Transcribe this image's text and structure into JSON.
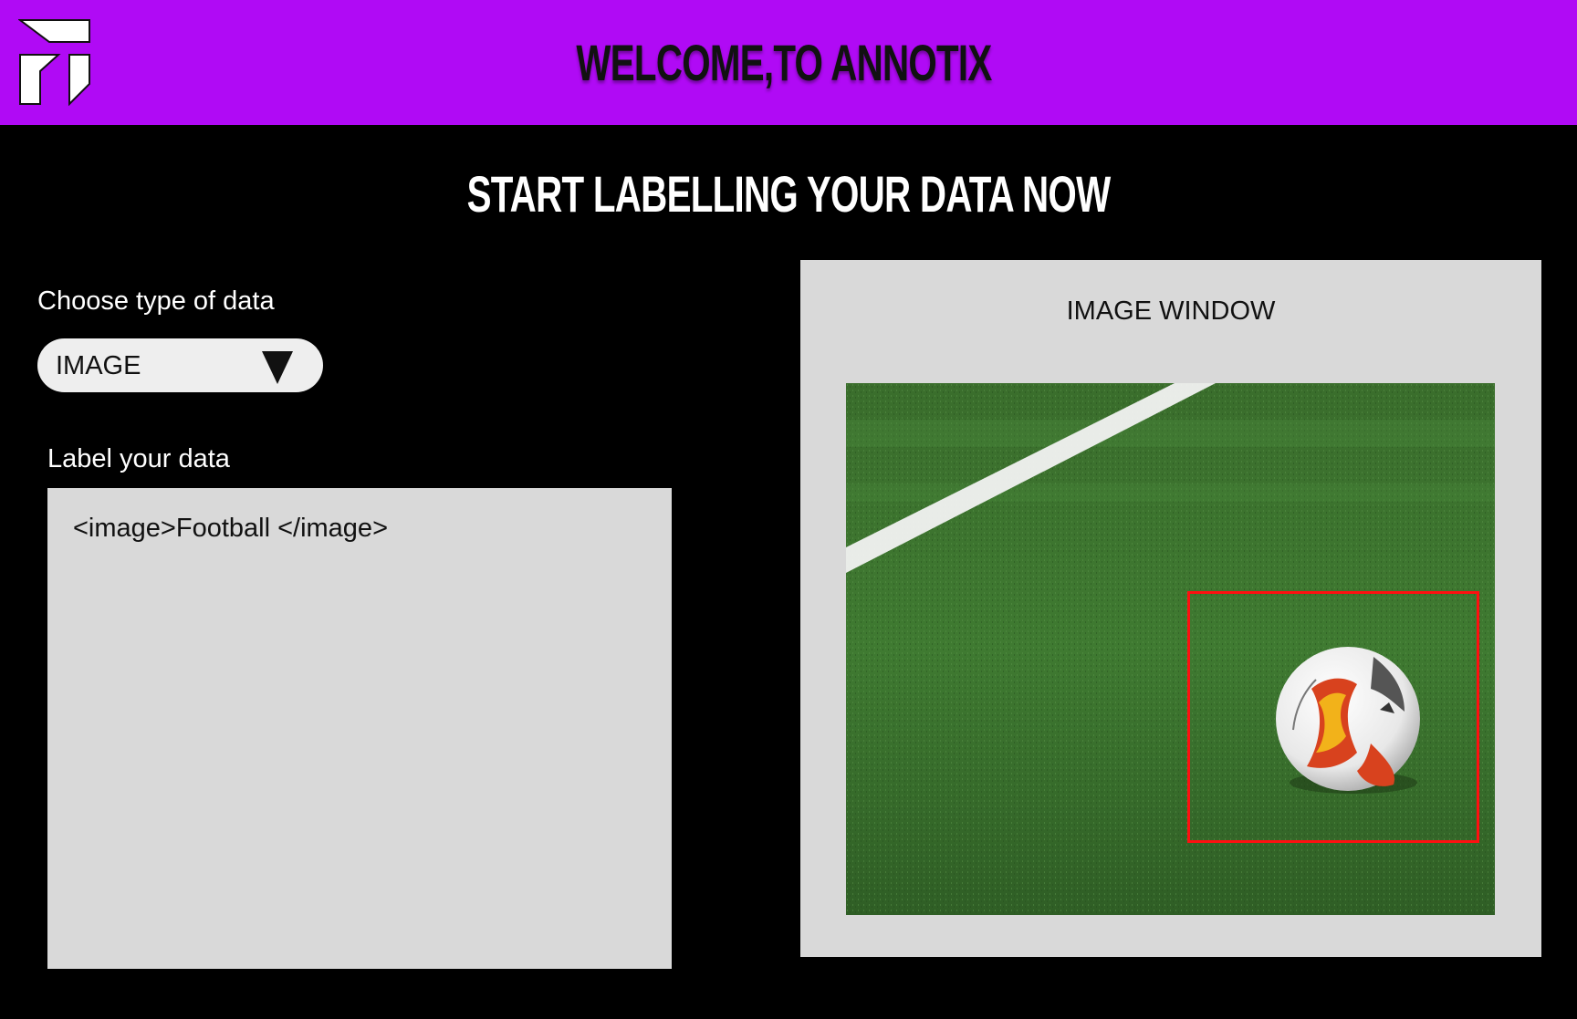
{
  "header": {
    "title": "WELCOME,TO ANNOTIX",
    "background_color": "#b00af5",
    "logo_icon": "annotix-logo-icon"
  },
  "main": {
    "subtitle": "START LABELLING YOUR DATA NOW"
  },
  "left_panel": {
    "choose_label": "Choose type of data",
    "data_type_select": {
      "selected_value": "IMAGE",
      "icon": "triangle-down-icon"
    },
    "label_title": "Label your data",
    "label_text": "<image>Football </image>"
  },
  "image_window": {
    "title": "IMAGE WINDOW",
    "image_content": "soccer ball on grass field",
    "bounding_box_color": "#ff1010"
  }
}
